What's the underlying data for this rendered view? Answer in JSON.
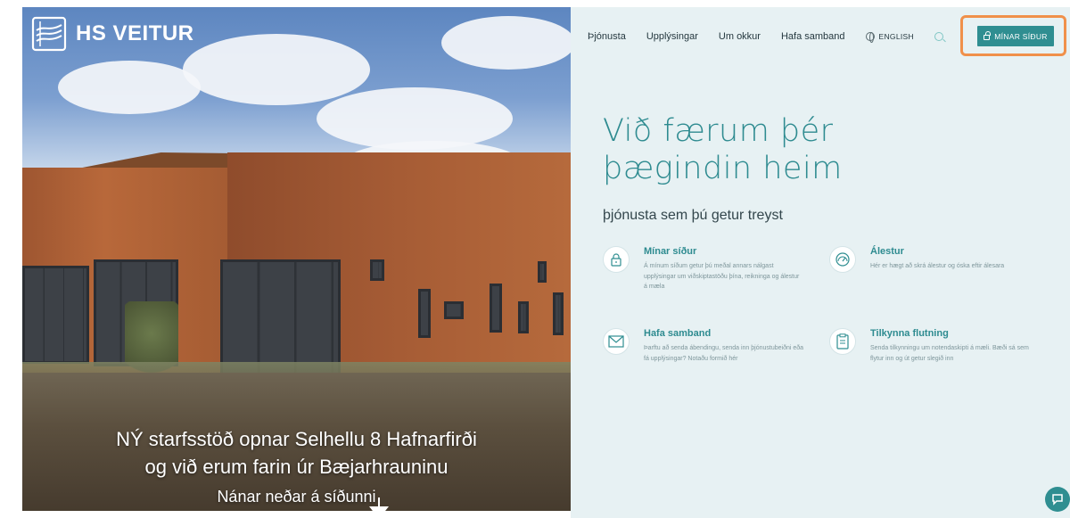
{
  "brand": {
    "name": "HS VEITUR"
  },
  "nav": {
    "items": [
      "Þjónusta",
      "Upplýsingar",
      "Um okkur",
      "Hafa samband"
    ],
    "language_label": "ENGLISH",
    "login_button_label": "MÍNAR SÍÐUR"
  },
  "hero": {
    "line1": "NÝ starfsstöð opnar Selhellu 8 Hafnarfirði",
    "line2": "og við erum farin úr Bæjarhrauninu",
    "line3": "Nánar neðar á síðunni"
  },
  "main": {
    "headline_line1": "Við færum þér",
    "headline_line2": "þægindin heim",
    "subheading": "þjónusta sem þú getur treyst"
  },
  "features": [
    {
      "title": "Mínar síður",
      "description": "Á mínum síðum getur þú meðal annars nálgast upplýsingar um viðskiptastöðu þína, reikninga og álestur á mæla",
      "icon": "lock-icon"
    },
    {
      "title": "Álestur",
      "description": "Hér er hægt að skrá álestur og óska eftir álesara",
      "icon": "gauge-icon"
    },
    {
      "title": "Hafa samband",
      "description": "Þarftu að senda ábendingu, senda inn þjónustubeiðni eða fá upplýsingar? Notaðu formið hér",
      "icon": "mail-icon"
    },
    {
      "title": "Tilkynna flutning",
      "description": "Senda tilkynningu um notendaskipti á mæli. Bæði sá sem flytur inn og út getur slegið inn",
      "icon": "clipboard-icon"
    }
  ],
  "colors": {
    "accent": "#2f8e91",
    "panel_bg": "#e7f1f3",
    "highlight": "#f0904a"
  }
}
